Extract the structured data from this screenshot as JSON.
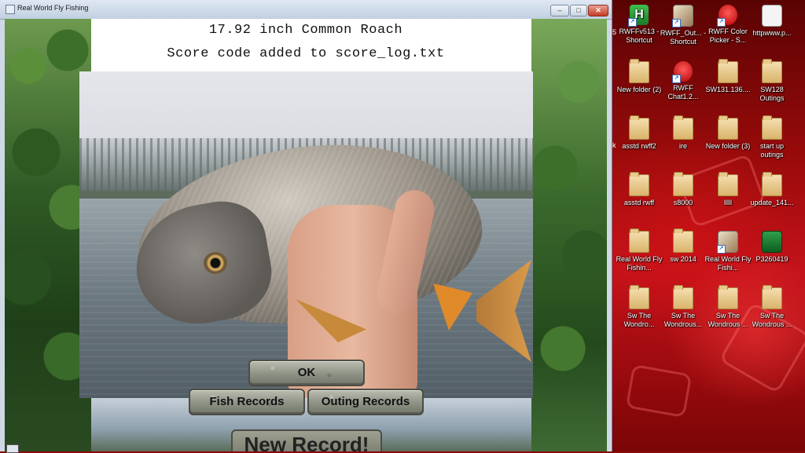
{
  "window": {
    "title": "Real World Fly Fishing",
    "minimize_glyph": "–",
    "maximize_glyph": "□",
    "close_glyph": "✕"
  },
  "game": {
    "catch_line": "17.92 inch Common Roach",
    "score_line": "Score code added to score_log.txt",
    "ok_label": "OK",
    "fish_records_label": "Fish Records",
    "outing_records_label": "Outing Records",
    "new_record_label": "New Record!"
  },
  "desktop": {
    "edge_text_1": "5",
    "edge_text_2": "k",
    "icons": [
      {
        "label": "RWFFv513 - Shortcut",
        "kind": "app-green",
        "glyph": "H",
        "shortcut": true
      },
      {
        "label": "RWFF_Out... - Shortcut",
        "kind": "app-pic",
        "glyph": "",
        "shortcut": true
      },
      {
        "label": "RWFF Color Picker - S...",
        "kind": "app-red",
        "glyph": "",
        "shortcut": true
      },
      {
        "label": "httpwww.p...",
        "kind": "app-doc",
        "glyph": "",
        "shortcut": false
      },
      {
        "label": "New folder (2)",
        "kind": "folder",
        "glyph": "",
        "shortcut": false
      },
      {
        "label": "RWFF Chat1.2...",
        "kind": "app-red",
        "glyph": "",
        "shortcut": true
      },
      {
        "label": "SW131.136....",
        "kind": "folder",
        "glyph": "",
        "shortcut": false
      },
      {
        "label": "SW128 Outings",
        "kind": "folder",
        "glyph": "",
        "shortcut": false
      },
      {
        "label": "asstd rwff2",
        "kind": "folder",
        "glyph": "",
        "shortcut": false
      },
      {
        "label": "ire",
        "kind": "folder",
        "glyph": "",
        "shortcut": false
      },
      {
        "label": "New folder (3)",
        "kind": "folder",
        "glyph": "",
        "shortcut": false
      },
      {
        "label": "start up outings",
        "kind": "folder",
        "glyph": "",
        "shortcut": false
      },
      {
        "label": "asstd rwff",
        "kind": "folder",
        "glyph": "",
        "shortcut": false
      },
      {
        "label": "s8000",
        "kind": "folder",
        "glyph": "",
        "shortcut": false
      },
      {
        "label": "lllll",
        "kind": "folder",
        "glyph": "",
        "shortcut": false
      },
      {
        "label": "update_141...",
        "kind": "folder",
        "glyph": "",
        "shortcut": false
      },
      {
        "label": "Real World Fly Fishin...",
        "kind": "folder",
        "glyph": "",
        "shortcut": false
      },
      {
        "label": "sw 2014",
        "kind": "folder",
        "glyph": "",
        "shortcut": false
      },
      {
        "label": "Real World Fly Fishi...",
        "kind": "app-pic",
        "glyph": "",
        "shortcut": true
      },
      {
        "label": "P3260419",
        "kind": "app-green2",
        "glyph": "",
        "shortcut": false
      },
      {
        "label": "Sw The Wondro...",
        "kind": "folder",
        "glyph": "",
        "shortcut": false
      },
      {
        "label": "Sw The Wondrous...",
        "kind": "folder",
        "glyph": "",
        "shortcut": false
      },
      {
        "label": "Sw The Wondrous ...",
        "kind": "folder",
        "glyph": "",
        "shortcut": false
      },
      {
        "label": "Sw The Wondrous ...",
        "kind": "folder",
        "glyph": "",
        "shortcut": false
      }
    ]
  }
}
